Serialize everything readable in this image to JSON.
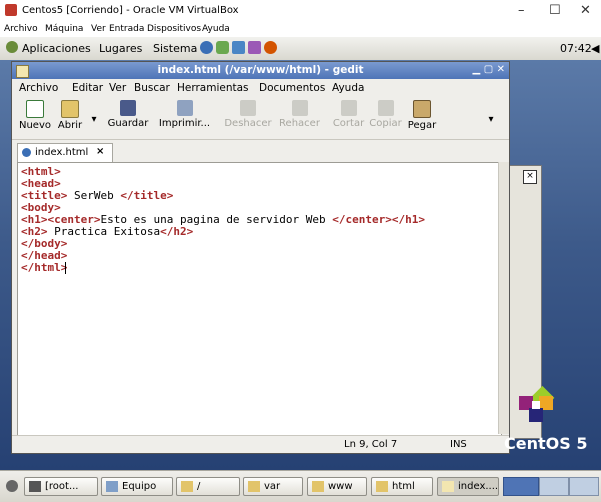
{
  "host": {
    "title": "Centos5 [Corriendo] - Oracle VM VirtualBox",
    "controls": [
      "–",
      "☐",
      "✕"
    ],
    "menu": [
      "Archivo",
      "Máquina",
      "Ver",
      "Entrada",
      "Dispositivos",
      "Ayuda"
    ]
  },
  "panel": {
    "menus": [
      "Aplicaciones",
      "Lugares",
      "Sistema"
    ],
    "clock": "07:42"
  },
  "gedit": {
    "title": "index.html (/var/www/html) - gedit",
    "menu": [
      "Archivo",
      "Editar",
      "Ver",
      "Buscar",
      "Herramientas",
      "Documentos",
      "Ayuda"
    ],
    "toolbar": {
      "nuevo": "Nuevo",
      "abrir": "Abrir",
      "guardar": "Guardar",
      "imprimir": "Imprimir...",
      "deshacer": "Deshacer",
      "rehacer": "Rehacer",
      "cortar": "Cortar",
      "copiar": "Copiar",
      "pegar": "Pegar"
    },
    "tab": {
      "label": "index.html",
      "close": "×"
    },
    "status": {
      "position": "Ln 9, Col 7",
      "mode": "INS"
    }
  },
  "code": [
    {
      "a": "<html>",
      "b": "",
      "c": "",
      "d": "",
      "e": ""
    },
    {
      "a": "<head>",
      "b": "",
      "c": "",
      "d": "",
      "e": ""
    },
    {
      "a": "<title>",
      "b": " SerWeb ",
      "c": "</title>",
      "d": "",
      "e": ""
    },
    {
      "a": "<body>",
      "b": "",
      "c": "",
      "d": "",
      "e": ""
    },
    {
      "a": "<h1><center>",
      "b": "Esto es una pagina de servidor Web ",
      "c": "</center></h1>",
      "d": "",
      "e": ""
    },
    {
      "a": "<h2>",
      "b": " Practica Exitosa",
      "c": "</h2>",
      "d": "",
      "e": ""
    },
    {
      "a": "</body>",
      "b": "",
      "c": "",
      "d": "",
      "e": ""
    },
    {
      "a": "</head>",
      "b": "",
      "c": "",
      "d": "",
      "e": ""
    },
    {
      "a": "</html>",
      "b": "",
      "c": "",
      "d": "",
      "e": ""
    }
  ],
  "logo_text": "CentOS 5",
  "taskbar": [
    "[root...",
    "Equipo",
    "/",
    "var",
    "www",
    "html",
    "index...."
  ],
  "colors": {
    "title_bar": "#5a7fbf",
    "tag": "#a52a2a",
    "desktop": "#3d5a8a"
  }
}
